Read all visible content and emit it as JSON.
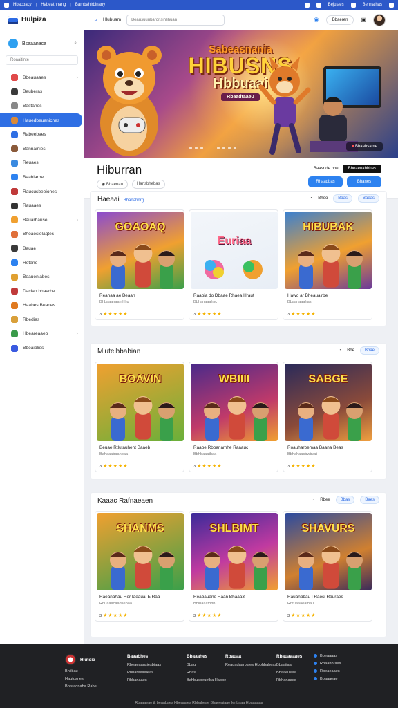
{
  "topbar": {
    "brand": "Hbacbacy",
    "link1": "Habeathhang",
    "link2": "Bambahirbinany",
    "r1": "Bejuiaes",
    "r2": "Bennaihas"
  },
  "header": {
    "logo": "Hulpiza",
    "search_label": "Hlubuam",
    "search_placeholder": "Beausuuribaronsinlihuan",
    "btn1": "Bbaeren"
  },
  "sidebar": {
    "user": "Bsaaanaca",
    "search_placeholder": "Roaaitinte",
    "items": [
      {
        "label": "Bbeauaaes",
        "color": "#e04a4a",
        "arrow": "›"
      },
      {
        "label": "Beuberas",
        "color": "#3a3a3a",
        "arrow": ""
      },
      {
        "label": "Bastanes",
        "color": "#888",
        "arrow": ""
      },
      {
        "label": "Hauedbeuanicnes",
        "color": "#d98a3a",
        "arrow": ""
      },
      {
        "label": "Rabeebaes",
        "color": "#2f6fe4",
        "arrow": ""
      },
      {
        "label": "Bannainies",
        "color": "#8a5a3a",
        "arrow": ""
      },
      {
        "label": "Reuaes",
        "color": "#3a8ae0",
        "arrow": ""
      },
      {
        "label": "Baahiarbe",
        "color": "#2d82f0",
        "arrow": ""
      },
      {
        "label": "Raucusbeeiones",
        "color": "#c03a3a",
        "arrow": ""
      },
      {
        "label": "Rauaaes",
        "color": "#333",
        "arrow": ""
      },
      {
        "label": "Bauarbause",
        "color": "#f0a030",
        "arrow": "›"
      },
      {
        "label": "Bhoaesielagtes",
        "color": "#e0703a",
        "arrow": ""
      },
      {
        "label": "Bauae",
        "color": "#3a3a3a",
        "arrow": ""
      },
      {
        "label": "Retane",
        "color": "#2d82f0",
        "arrow": ""
      },
      {
        "label": "Beaueniabes",
        "color": "#e0a030",
        "arrow": ""
      },
      {
        "label": "Dacian bhaarbe",
        "color": "#c03a3a",
        "arrow": ""
      },
      {
        "label": "Haabes Beanes",
        "color": "#e07a20",
        "arrow": ""
      },
      {
        "label": "Rbedias",
        "color": "#d9a03a",
        "arrow": ""
      },
      {
        "label": "Hbeareaaeb",
        "color": "#3a9a4a",
        "arrow": "›"
      },
      {
        "label": "Bbeaiblies",
        "color": "#3a5ae0",
        "arrow": ""
      }
    ]
  },
  "hero": {
    "line1": "Sabeasnania",
    "line2": "HIBUSNS",
    "line3": "Hbbuaai",
    "line4": "Rbaadtaaeu",
    "badge": "Bhaahsame"
  },
  "detail": {
    "title": "Hiburran",
    "tag1": "Bbaenau",
    "tag2": "Hansbhebas",
    "link": "Baasr de bhe",
    "dark_btn": "Bbeaeuabbhas",
    "btn1": "Rhaadbas",
    "btn2": "Bhanes"
  },
  "sections": [
    {
      "title": "Haeaai",
      "sub": "Bbanahnrg",
      "r1": "Bheo",
      "r2": "Baas",
      "r3": "Baeas",
      "cards": [
        {
          "title": "Reanaa ae Beaan",
          "sub": "Bhbaaanaamhhu",
          "rating": "3",
          "stars": "★★★★★",
          "img": "GOAOAQ",
          "bg": "linear-gradient(160deg,#8a4ad0,#f0a030 55%,#3aa04a)"
        },
        {
          "title": "Raabia do Dbaae Rhaea Hraut",
          "sub": "Bbhanaaahsc",
          "rating": "3",
          "stars": "★★★★★",
          "img": "Euriaa",
          "bg": "linear-gradient(160deg,#f3f6fa,#e8eef6)"
        },
        {
          "title": "Hawo ar Bheauairbe",
          "sub": "Bbaanaaahas",
          "rating": "3",
          "stars": "★★★★★",
          "img": "HIBUBAK",
          "bg": "linear-gradient(160deg,#3a80d0,#f0a030 55%,#6a3a9a)"
        }
      ]
    },
    {
      "title": "Mlutelbbabian",
      "sub": "",
      "r1": "Bbe",
      "r2": "Bbae",
      "r3": "",
      "cards": [
        {
          "title": "Beuae Rtlutauhent Baaeb",
          "sub": "Bahaaabaanbaa",
          "rating": "3",
          "stars": "★★★★★",
          "img": "BOAVIN",
          "bg": "linear-gradient(160deg,#f0a030,#6ab03a)"
        },
        {
          "title": "Raabe Rbbanamhe Raaauc",
          "sub": "Bbhbaaatbaa",
          "rating": "3",
          "stars": "★★★★★",
          "img": "WBIIII",
          "bg": "linear-gradient(160deg,#4a2a8a,#c03a6a 60%,#f0a030)"
        },
        {
          "title": "Roauharbemaa Baana Beas",
          "sub": "Bbhahaacbwbvat",
          "rating": "3",
          "stars": "★★★★★",
          "img": "SABGE",
          "bg": "linear-gradient(160deg,#2a2a5a,#8a4a3a 60%,#f0a040)"
        }
      ]
    },
    {
      "title": "Kaaac Rafnaeaen",
      "sub": "",
      "r1": "Rbee",
      "r2": "Bbas",
      "r3": "Baes",
      "cards": [
        {
          "title": "Raeanahau Rer Iaeauai E Raa",
          "sub": "Rbuaaacaadsebaa",
          "rating": "3",
          "stars": "★★★★★",
          "img": "SHANMS",
          "bg": "linear-gradient(160deg,#f0a030,#3aa04a)"
        },
        {
          "title": "Reabauane Haan Bhaaa3",
          "sub": "Bhihaaathhb",
          "rating": "3",
          "stars": "★★★★★",
          "img": "SHLBIMT",
          "bg": "linear-gradient(160deg,#3a2a9a,#c03aa0 55%,#f0a030)"
        },
        {
          "title": "Rauanbbau I Raosi Rauraes",
          "sub": "Rnfuaaaeamau",
          "rating": "3",
          "stars": "★★★★★",
          "img": "SHAVURS",
          "bg": "linear-gradient(160deg,#2a4aa0,#d08030 60%,#3a2a5a)"
        }
      ]
    }
  ],
  "footer": {
    "brand": "Hlutoia",
    "brand_sub": "Bhiibau",
    "brand_sub2": "Hautusnes",
    "brand_sub3": "Bbisiadnaba Rabe",
    "col1": {
      "h": "Baaabhes",
      "items": [
        "Rbeaeaausiesbiaas",
        "Rbbareeaaleas",
        "Rbhanaaes"
      ]
    },
    "col2": {
      "h": "Bbaaahes",
      "items": [
        "Bbau",
        "Rbas",
        "Bahbusbeuetba Habbe"
      ]
    },
    "col3": {
      "h": "Rbauaa",
      "items": [
        "Reauadaarbiaes Hbbhbaheas"
      ]
    },
    "col4": {
      "h": "Rbauaaaaes",
      "items": [
        "Bbaaiiaa",
        "Bbaaeuses",
        "Rbhanaaes"
      ]
    },
    "col5": {
      "h": "",
      "items": [
        "Bbeaaaas",
        "Rhaahbraas",
        "Rbeaeaaes",
        "Bbaaaeae"
      ]
    },
    "copy": "Rbaaaeae & beaabaes Hbeaaaes Rbbabeae Bhaeeaiaae Ienbaaa Hbaaaaaa"
  }
}
